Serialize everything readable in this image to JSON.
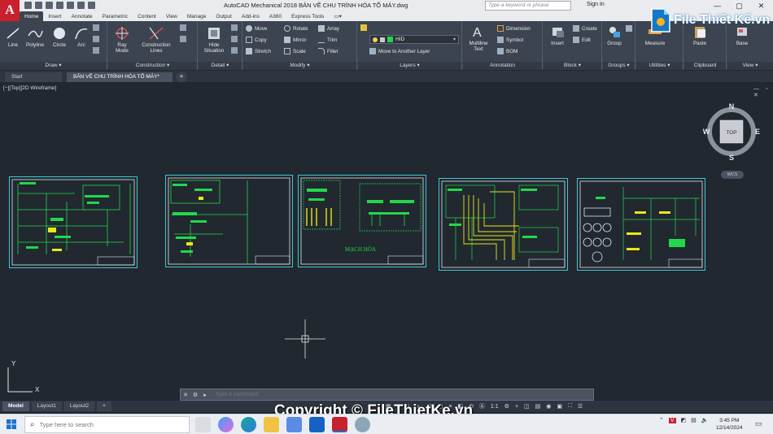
{
  "window": {
    "title": "AutoCAD Mechanical 2018   BẢN VẼ CHU TRÌNH HÓA TỔ MÁY.dwg",
    "search_placeholder": "Type a keyword or phrase",
    "signin": "Sign In",
    "app_logo": "A"
  },
  "ribbon_tabs": [
    "Home",
    "Insert",
    "Annotate",
    "Parametric",
    "Content",
    "View",
    "Manage",
    "Output",
    "Add-ins",
    "A360",
    "Express Tools"
  ],
  "panels": {
    "draw": {
      "title": "Draw ▾",
      "line": "Line",
      "polyline": "Polyline",
      "circle": "Circle",
      "arc": "Arc"
    },
    "construction": {
      "title": "Construction ▾",
      "ray": "Ray",
      "ray2": "Mode",
      "lines": "Construction",
      "lines2": "Lines"
    },
    "detail": {
      "title": "Detail ▾",
      "hide": "Hide",
      "hide2": "Situation"
    },
    "modify": {
      "title": "Modify ▾",
      "move": "Move",
      "rotate": "Rotate",
      "array": "Array",
      "copy": "Copy",
      "mirror": "Mirror",
      "trim": "Trim",
      "stretch": "Stretch",
      "scale": "Scale",
      "fillet": "Fillet"
    },
    "layers": {
      "title": "Layers ▾",
      "layer_value": "HID",
      "move_layer": "Move to Another Layer"
    },
    "annotation": {
      "title": "Annotation",
      "mtext": "Multiline",
      "mtext2": "Text",
      "dimension": "Dimension",
      "symbol": "Symbol",
      "bom": "BOM"
    },
    "block": {
      "title": "Block ▾",
      "insert": "Insert",
      "create": "Create",
      "edit": "Edit"
    },
    "groups": {
      "title": "Groups ▾",
      "group": "Group"
    },
    "utilities": {
      "title": "Utilities ▾",
      "measure": "Measure"
    },
    "clipboard": {
      "title": "Clipboard",
      "paste": "Paste"
    },
    "view": {
      "title": "View ▾",
      "base": "Base"
    }
  },
  "file_tabs": {
    "start": "Start",
    "drawing": "BẢN VẼ CHU TRÌNH HÓA TỔ MÁY*",
    "add": "+"
  },
  "viewport": {
    "label": "[−][Top][2D Wireframe]",
    "controls": "— ▫ ✕"
  },
  "sheets": {
    "sheet3_label": "MẠCH HÒA"
  },
  "viewcube": {
    "n": "N",
    "s": "S",
    "e": "E",
    "w": "W",
    "top": "TOP",
    "wcs": "WCS"
  },
  "ucs": {
    "x": "X",
    "y": "Y"
  },
  "command": {
    "placeholder": "Type a command"
  },
  "layout_tabs": [
    "Model",
    "Layout1",
    "Layout2"
  ],
  "status": {
    "scale": "1:1"
  },
  "watermark": "Copyright © FileThietKe.vn",
  "brand": "File Thiết Kế.vn",
  "taskbar": {
    "search_placeholder": "Type here to search",
    "time": "3:45 PM",
    "date": "12/14/2024"
  },
  "colors": {
    "ribbon": "#3c4451",
    "canvas": "#212830",
    "sheet_border": "#3fc8d2",
    "geometry_green": "#22d84a",
    "geometry_yellow": "#e8e81a"
  }
}
